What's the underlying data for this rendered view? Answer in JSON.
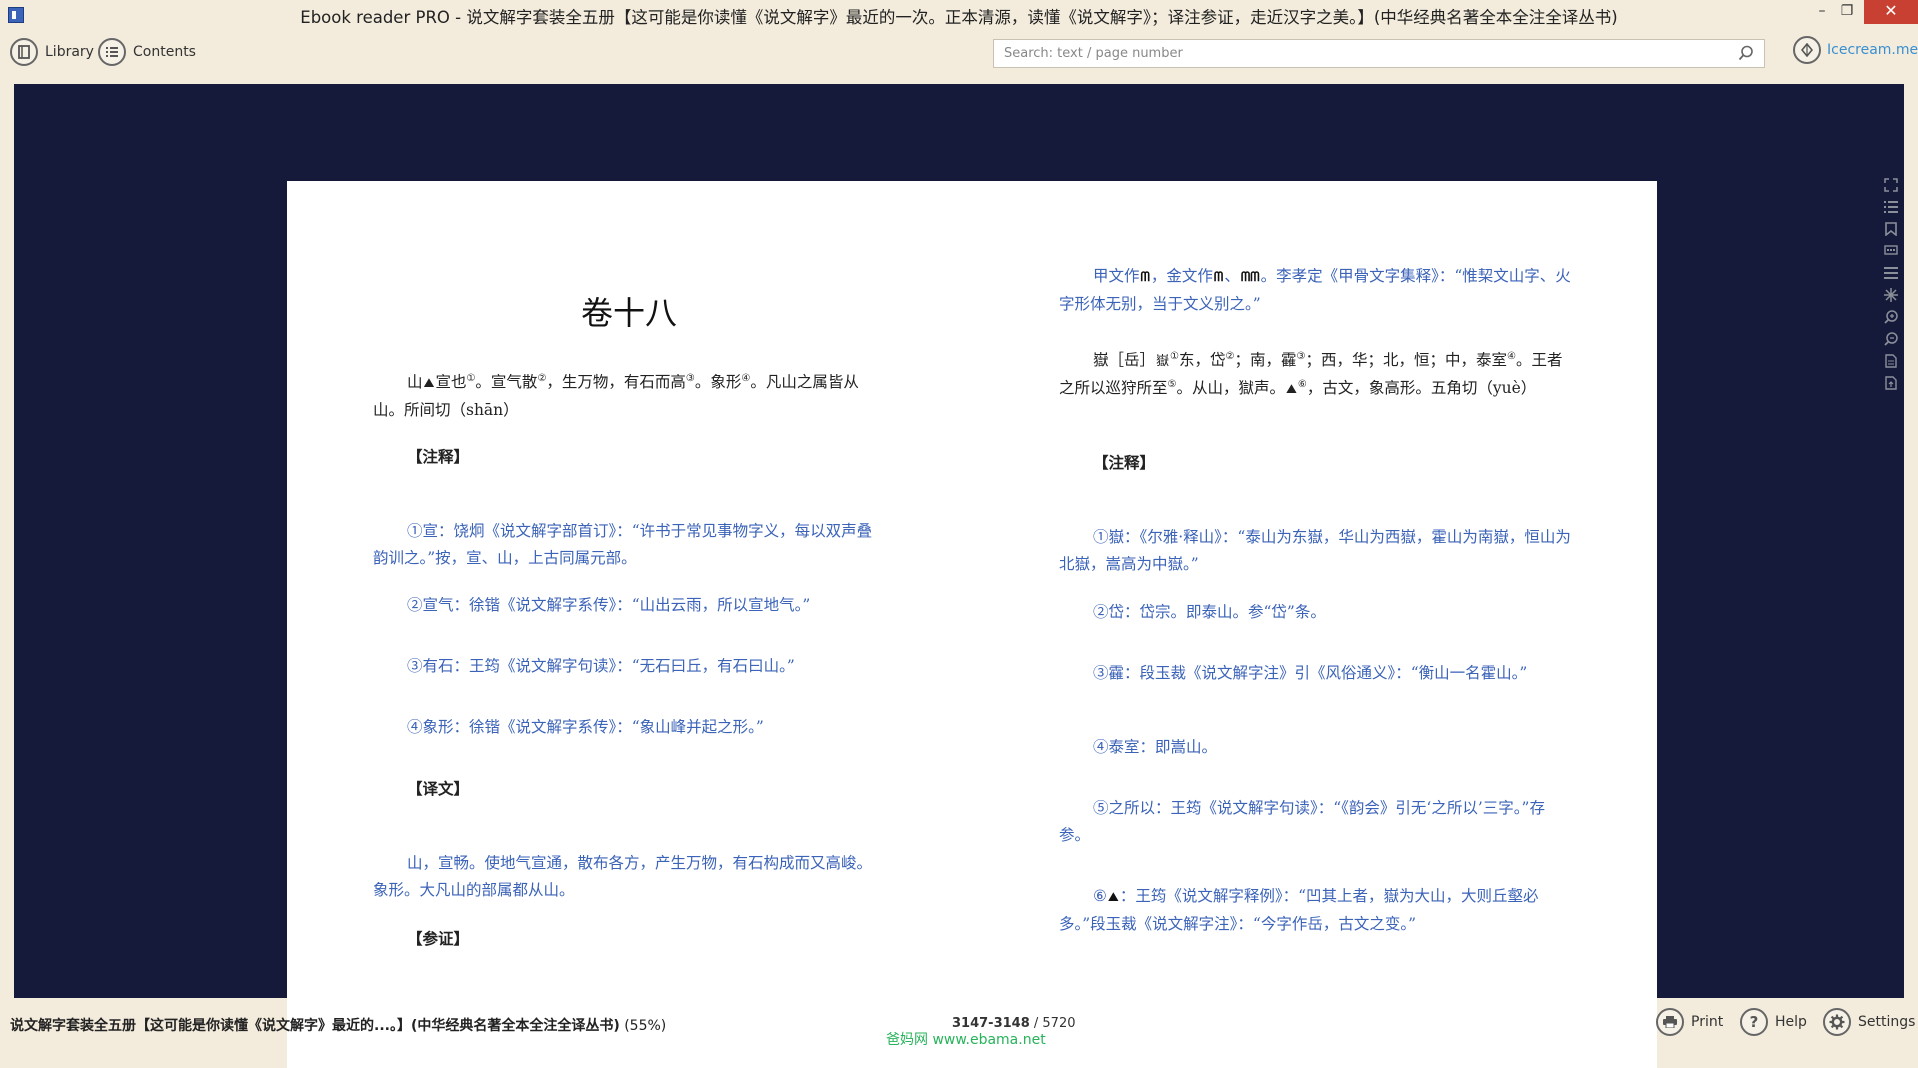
{
  "window": {
    "title": "Ebook reader PRO - 说文解字套装全五册【这可能是你读懂《说文解字》最近的一次。正本清源，读懂《说文解字》；译注参证，走近汉字之美。】(中华经典名著全本全注全译丛书)",
    "minimize": "–",
    "maximize": "❐",
    "close": "✕"
  },
  "toolbar": {
    "library_label": "Library",
    "contents_label": "Contents",
    "search_placeholder": "Search: text / page number",
    "account_name": "Icecream.me"
  },
  "left_page": {
    "chapter_title": "卷十八",
    "entry": {
      "head": "山",
      "glyph": "⛰",
      "text_a": "宣也",
      "n1": "①",
      "text_b": "。宣气散",
      "n2": "②",
      "text_c": "，生万物，有石而高",
      "n3": "③",
      "text_d": "。象形",
      "n4": "④",
      "text_e": "。凡山之属皆从山。所间切（shān）"
    },
    "notes_heading": "【注释】",
    "notes": [
      "①宣：饶炯《说文解字部首订》：“许书于常见事物字义，每以双声叠韵训之。”按，宣、山，上古同属元部。",
      "②宣气：徐锴《说文解字系传》：“山出云雨，所以宣地气。”",
      "③有石：王筠《说文解字句读》：“无石曰丘，有石曰山。”",
      "④象形：徐锴《说文解字系传》：“象山峰并起之形。”"
    ],
    "translation_heading": "【译文】",
    "translation": "山，宣畅。使地气宣通，散布各方，产生万物，有石构成而又高峻。象形。大凡山的部属都从山。",
    "evidence_heading": "【参证】"
  },
  "right_page": {
    "evidence": {
      "a": "甲文作",
      "g1": "ᗰ",
      "b": "，金文作",
      "g2": "ᗰ",
      "c": "、",
      "g3": "ᗰᗰ",
      "d": "。李孝定《甲骨文字集释》：“惟栔文山字、火字形体无别，当于文义别之。”"
    },
    "entry": {
      "text_a": "嶽［岳］",
      "glyph": "嶽",
      "n1": "①",
      "text_b": "东，岱",
      "n2": "②",
      "text_c": "；南，靃",
      "n3": "③",
      "text_d": "；西，华；北，恒；中，泰室",
      "n4": "④",
      "text_e": "。王者之所以巡狩所至",
      "n5": "⑤",
      "text_f": "。从山，獄声。",
      "glyph2": "⛰",
      "n6": "⑥",
      "text_g": "，古文，象高形。五角切（yuè）"
    },
    "notes_heading": "【注释】",
    "notes": [
      "①嶽：《尔雅·释山》：“泰山为东嶽，华山为西嶽，霍山为南嶽，恒山为北嶽，嵩高为中嶽。”",
      "②岱：岱宗。即泰山。参“岱”条。",
      "③靃：段玉裁《说文解字注》引《风俗通义》：“衡山一名霍山。”",
      "④泰室：即嵩山。",
      "⑤之所以：王筠《说文解字句读》：“《韵会》引无‘之所以’三字。”存参。"
    ],
    "note6_prefix": "⑥",
    "note6_glyph": "⛰",
    "note6_text": "：王筠《说文解字释例》：“凹其上者，嶽为大山，大则丘壑必多。”段玉裁《说文解字注》：“今字作岳，古文之变。”"
  },
  "side_tools": [
    "fullscreen-icon",
    "list-icon",
    "bookmark-icon",
    "comment-icon",
    "text-icon",
    "brightness-icon",
    "zoom-in-icon",
    "zoom-out-icon",
    "page-icon",
    "export-icon"
  ],
  "statusbar": {
    "book_title": "说文解字套装全五册【这可能是你读懂《说文解字》最近的...。】(中华经典名著全本全注全译丛书)",
    "progress": "(55%)",
    "page_current": "3147-3148",
    "page_total": " / 5720",
    "print_label": "Print",
    "help_label": "Help",
    "settings_label": "Settings",
    "watermark": "爸妈网 www.ebama.net"
  },
  "colors": {
    "chrome_bg": "#f3ecdd",
    "reader_bg": "#161a3a",
    "note_blue": "#3b63b8",
    "close_red": "#c84031",
    "watermark_green": "#27b35a"
  }
}
